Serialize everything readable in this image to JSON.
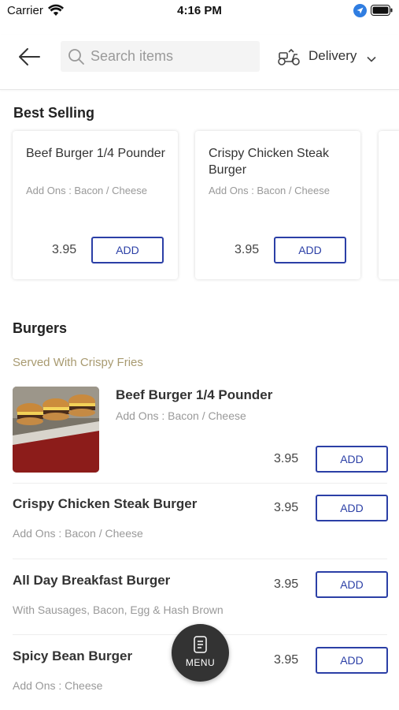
{
  "status_bar": {
    "carrier": "Carrier",
    "time": "4:16 PM"
  },
  "header": {
    "search_placeholder": "Search items",
    "delivery_label": "Delivery"
  },
  "best_selling": {
    "title": "Best Selling",
    "items": [
      {
        "name": "Beef Burger 1/4 Pounder",
        "addons": "Add Ons : Bacon / Cheese",
        "price": "3.95",
        "add_label": "ADD"
      },
      {
        "name": "Crispy Chicken Steak Burger",
        "addons": "Add Ons : Bacon / Cheese",
        "price": "3.95",
        "add_label": "ADD"
      }
    ]
  },
  "burgers": {
    "title": "Burgers",
    "subtitle": "Served With Crispy Fries",
    "items": [
      {
        "name": "Beef Burger 1/4 Pounder",
        "addons": "Add Ons : Bacon / Cheese",
        "price": "3.95",
        "add_label": "ADD"
      },
      {
        "name": "Crispy Chicken Steak Burger",
        "addons": "Add Ons : Bacon / Cheese",
        "price": "3.95",
        "add_label": "ADD"
      },
      {
        "name": "All Day Breakfast Burger",
        "addons": "With Sausages, Bacon, Egg & Hash Brown",
        "price": "3.95",
        "add_label": "ADD"
      },
      {
        "name": "Spicy Bean Burger",
        "addons": "Add Ons : Cheese",
        "price": "3.95",
        "add_label": "ADD"
      }
    ]
  },
  "menu_button": {
    "label": "MENU"
  },
  "colors": {
    "accent": "#2b3fa6",
    "subtitle": "#a89a70",
    "fab": "#333333"
  },
  "icons": [
    "wifi-icon",
    "location-icon",
    "battery-icon",
    "back-arrow-icon",
    "search-icon",
    "scooter-icon",
    "chevron-down-icon",
    "menu-icon"
  ]
}
